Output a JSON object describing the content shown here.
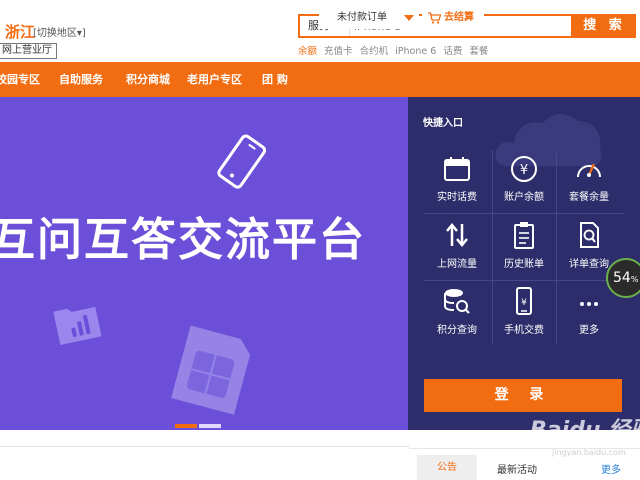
{
  "header": {
    "region": "浙江",
    "switch_region": "[切换地区▾]",
    "online_hall": "网上营业厅",
    "search": {
      "category": "服务",
      "placeholder": "iPhone 5",
      "button": "搜 索"
    },
    "hot_links": [
      "余额",
      "充值卡",
      "合约机",
      "iPhone 6",
      "话费",
      "套餐"
    ]
  },
  "nav": {
    "items": [
      "校园专区",
      "自助服务",
      "积分商城",
      "老用户专区",
      "团  购"
    ],
    "order_select": "未付款订单",
    "checkout": "去结算"
  },
  "banner": {
    "title": "互问互答交流平台"
  },
  "quick_access": {
    "title": "快捷入口",
    "items": [
      {
        "label": "实时话费",
        "icon": "calendar-icon"
      },
      {
        "label": "账户余额",
        "icon": "yuan-icon"
      },
      {
        "label": "套餐余量",
        "icon": "gauge-icon"
      },
      {
        "label": "上网流量",
        "icon": "updown-arrows-icon"
      },
      {
        "label": "历史账单",
        "icon": "clipboard-icon"
      },
      {
        "label": "详单查询",
        "icon": "search-document-icon"
      },
      {
        "label": "积分查询",
        "icon": "coins-search-icon"
      },
      {
        "label": "手机交费",
        "icon": "phone-yuan-icon"
      },
      {
        "label": "更多",
        "icon": "more-icon"
      }
    ],
    "login": "登 录"
  },
  "speed_badge": {
    "value": "54",
    "unit": "%"
  },
  "bottom": {
    "notice_tab": "公告",
    "news_title": "最新活动",
    "more": "更多"
  },
  "watermark": {
    "main": "Baidu 经验",
    "sub": "jingyan.baidu.com"
  },
  "colors": {
    "accent": "#f26c12",
    "banner": "#6b4fd8",
    "panel": "#2e2d6b"
  }
}
